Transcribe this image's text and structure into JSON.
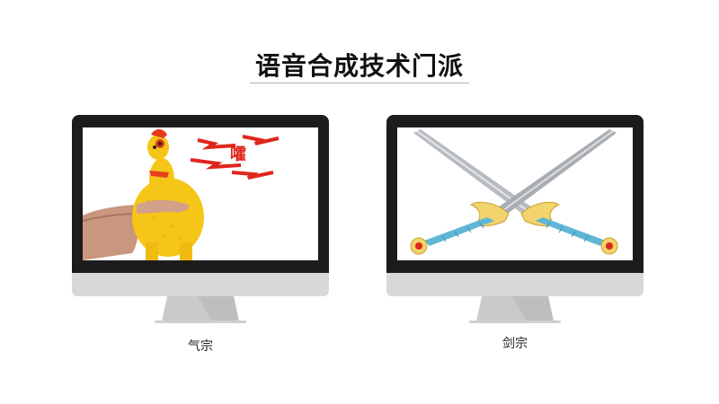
{
  "page": {
    "title": "语音合成技术门派"
  },
  "monitors": [
    {
      "caption": "气宗",
      "scene": "rubber-chicken",
      "shout_text": "嚯"
    },
    {
      "caption": "剑宗",
      "scene": "crossed-swords"
    }
  ]
}
